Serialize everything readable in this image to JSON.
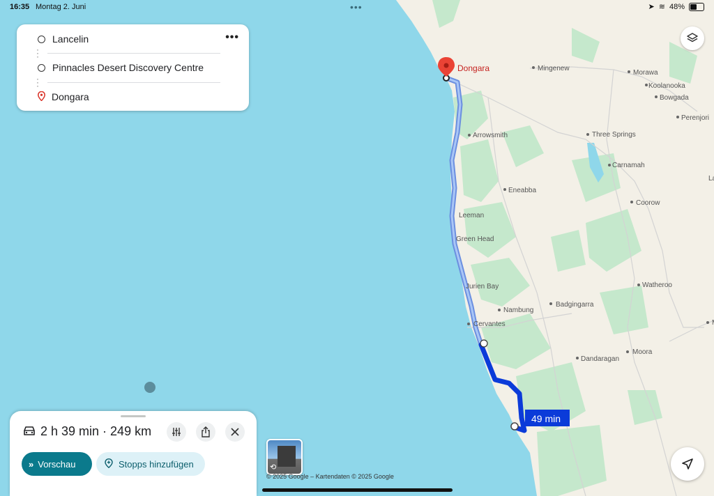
{
  "status_bar": {
    "time": "16:35",
    "date": "Montag 2. Juni",
    "battery": "48%"
  },
  "route": {
    "stops": [
      {
        "label": "Lancelin",
        "type": "circle"
      },
      {
        "label": "Pinnacles Desert Discovery Centre",
        "type": "circle"
      },
      {
        "label": "Dongara",
        "type": "pin"
      }
    ],
    "more_icon": "more-horizontal-icon"
  },
  "map": {
    "destination_label": "Dongara",
    "route_time_badge": "49 min",
    "places": [
      "Mingenew",
      "Morawa",
      "Koolanooka",
      "Bowgada",
      "Perenjori",
      "Arrowsmith",
      "Three Springs",
      "Carnamah",
      "Eneabba",
      "Coorow",
      "Leeman",
      "Green Head",
      "Jurien Bay",
      "Nambung",
      "Badgingarra",
      "Watheroo",
      "Cervantes",
      "Moora",
      "Dandaragan",
      "Miling",
      "La"
    ],
    "copyright": "© 2025 Google – Kartendaten © 2025 Google",
    "colors": {
      "water": "#8fd7ea",
      "land": "#f4f1e8",
      "park": "#bfe6c6",
      "route": "#1a73e8",
      "route_active": "#0b3bd9"
    }
  },
  "sheet": {
    "summary": "2 h 39 min · 249 km",
    "preview_label": "Vorschau",
    "add_stops_label": "Stopps hinzufügen"
  }
}
